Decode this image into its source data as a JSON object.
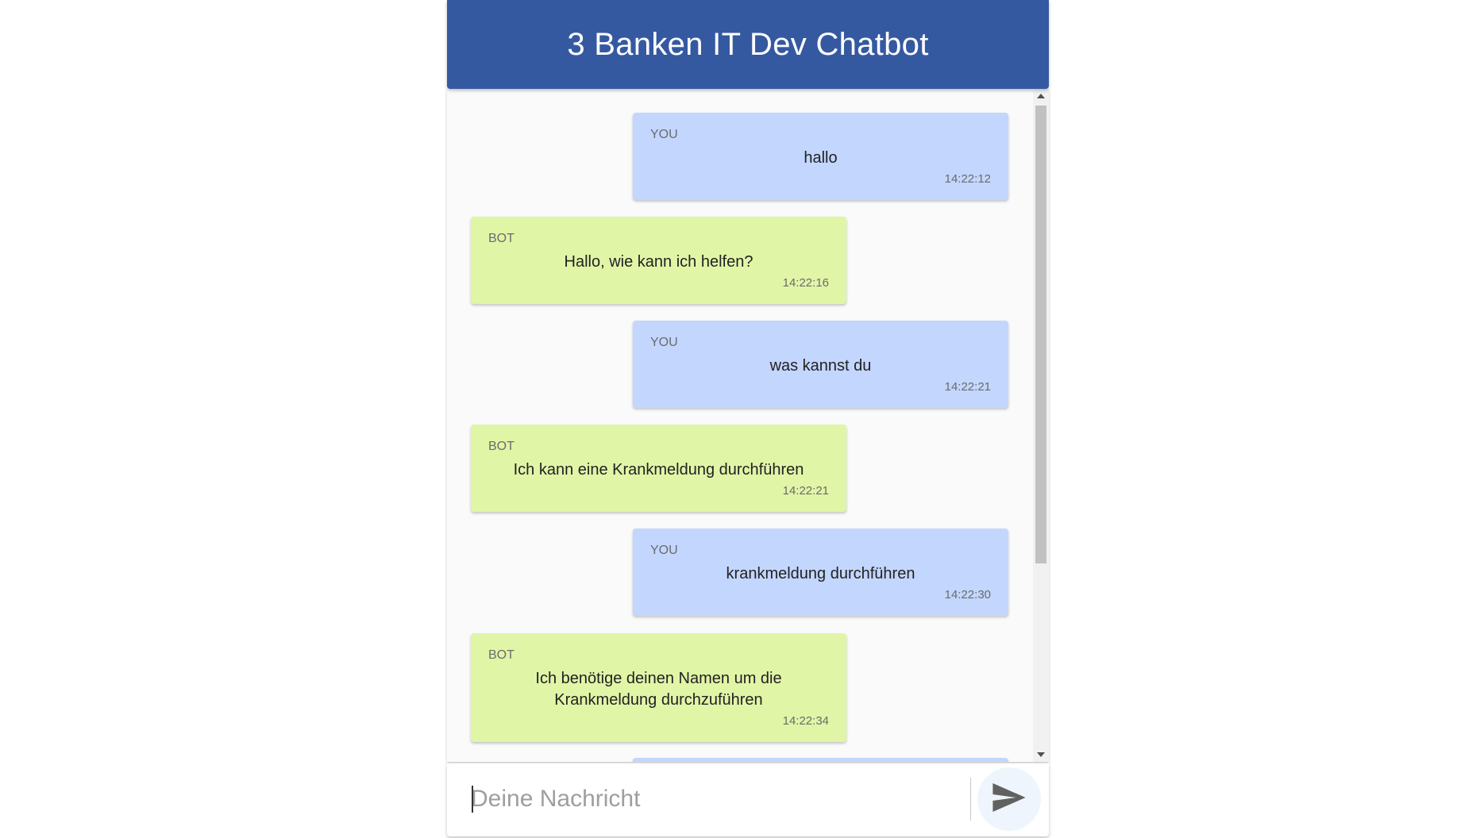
{
  "header": {
    "title": "3 Banken IT Dev Chatbot"
  },
  "messages": [
    {
      "sender": "YOU",
      "text": "hallo",
      "time": "14:22:12"
    },
    {
      "sender": "BOT",
      "text": "Hallo, wie kann ich helfen?",
      "time": "14:22:16"
    },
    {
      "sender": "YOU",
      "text": "was kannst du",
      "time": "14:22:21"
    },
    {
      "sender": "BOT",
      "text": "Ich kann eine Krankmeldung durchführen",
      "time": "14:22:21"
    },
    {
      "sender": "YOU",
      "text": "krankmeldung durchführen",
      "time": "14:22:30"
    },
    {
      "sender": "BOT",
      "text": "Ich benötige deinen Namen um die Krankmeldung durchzuführen",
      "time": "14:22:34"
    }
  ],
  "input": {
    "placeholder": "Deine Nachricht",
    "value": ""
  },
  "icons": {
    "send": "send-icon",
    "scroll_up": "scroll-up-arrow-icon",
    "scroll_down": "scroll-down-arrow-icon"
  },
  "colors": {
    "header": "#3559a1",
    "you_bubble": "#c3d6fd",
    "bot_bubble": "#e1f5a7",
    "send_button_bg": "#eef5fd"
  }
}
